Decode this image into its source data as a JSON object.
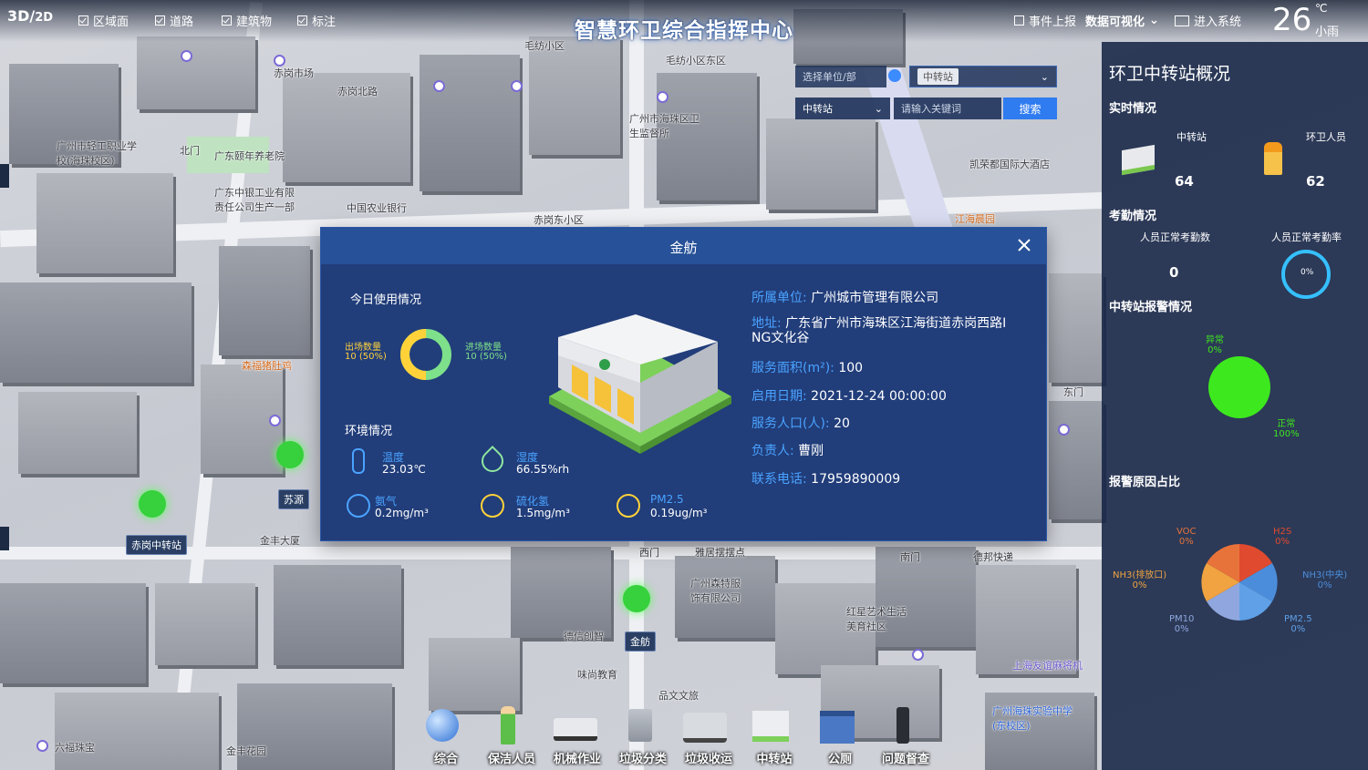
{
  "top": {
    "mode_3d": "3D",
    "mode_2d": "2D",
    "layers": [
      {
        "label": "区域面",
        "checked": true
      },
      {
        "label": "道路",
        "checked": true
      },
      {
        "label": "建筑物",
        "checked": true
      },
      {
        "label": "标注",
        "checked": true
      }
    ],
    "title": "智慧环卫综合指挥中心",
    "event_report": "事件上报",
    "data_viz": "数据可视化",
    "enter_system": "进入系统",
    "temperature": "26",
    "temp_unit": "℃",
    "weather": "小雨"
  },
  "search": {
    "unit_placeholder": "选择单位/部",
    "chip": "中转站",
    "type_select": "中转站",
    "keyword_placeholder": "请输入关键词",
    "search_button": "搜索"
  },
  "map_labels": {
    "station_main": "赤岗中转站",
    "station_sy": "苏源",
    "station_jf": "金舫",
    "labels": [
      "毛纺小区",
      "毛纺小区东区",
      "赤岗市场",
      "赤岗北路",
      "广州市轻工职业学校(海珠校区)",
      "广东颐年养老院",
      "广东中银工业有限责任公司生产一部",
      "中国农业银行",
      "广州市海珠区卫生监督所",
      "赤岗东小区",
      "金丰大厦",
      "德信创智",
      "味尚教育",
      "品文文旅",
      "金丰花园",
      "六福珠宝",
      "广州森特服饰有限公司",
      "红星艺术生活美育社区",
      "德邦快递",
      "雅居摆摆点",
      "上海友谊麻将机",
      "广州海珠实验中学(东校区)",
      "凯荣都国际大酒店",
      "江海晨园",
      "森福猪肚鸡",
      "东门",
      "南门",
      "西门",
      "北门"
    ]
  },
  "panel": {
    "title": "环卫中转站概况",
    "realtime": "实时情况",
    "station_label": "中转站",
    "station_count": "64",
    "staff_label": "环卫人员",
    "staff_count": "62",
    "attendance": "考勤情况",
    "att_normal_label": "人员正常考勤数",
    "att_normal_count": "0",
    "att_rate_label": "人员正常考勤率",
    "att_rate": "0%",
    "alarm_title": "中转站报警情况",
    "alarm_abnormal": "异常",
    "alarm_abnormal_pct": "0%",
    "alarm_normal": "正常",
    "alarm_normal_pct": "100%",
    "reason_title": "报警原因占比",
    "reasons": [
      {
        "name": "VOC",
        "pct": "0%"
      },
      {
        "name": "H2S",
        "pct": "0%"
      },
      {
        "name": "NH3(排放口)",
        "pct": "0%"
      },
      {
        "name": "NH3(中央)",
        "pct": "0%"
      },
      {
        "name": "PM10",
        "pct": "0%"
      },
      {
        "name": "PM2.5",
        "pct": "0%"
      }
    ],
    "colors": {
      "normal": "#3ee81e",
      "ring": "#35c0ff"
    }
  },
  "modal": {
    "title": "金舫",
    "usage_title": "今日使用情况",
    "out_label": "出场数量",
    "out_value": "10 (50%)",
    "in_label": "进场数量",
    "in_value": "10 (50%)",
    "env_title": "环境情况",
    "env": {
      "temp_label": "温度",
      "temp_value": "23.03℃",
      "hum_label": "湿度",
      "hum_value": "66.55%rh",
      "nh3_label": "氨气",
      "nh3_value": "0.2mg/m³",
      "h2s_label": "硫化氢",
      "h2s_value": "1.5mg/m³",
      "pm_label": "PM2.5",
      "pm_value": "0.19ug/m³"
    },
    "info": {
      "unit_k": "所属单位:",
      "unit_v": "广州城市管理有限公司",
      "addr_k": "地址:",
      "addr_v1": "广东省广州市海珠区江海街道赤岗西路I",
      "addr_v2": "NG文化谷",
      "area_k": "服务面积(m²):",
      "area_v": "100",
      "date_k": "启用日期:",
      "date_v": "2021-12-24 00:00:00",
      "pop_k": "服务人口(人):",
      "pop_v": "20",
      "lead_k": "负责人:",
      "lead_v": "曹刚",
      "tel_k": "联系电话:",
      "tel_v": "17959890009"
    }
  },
  "dock": [
    {
      "label": "综合"
    },
    {
      "label": "保洁人员"
    },
    {
      "label": "机械作业"
    },
    {
      "label": "垃圾分类"
    },
    {
      "label": "垃圾收运"
    },
    {
      "label": "中转站"
    },
    {
      "label": "公厕"
    },
    {
      "label": "问题督查"
    }
  ]
}
